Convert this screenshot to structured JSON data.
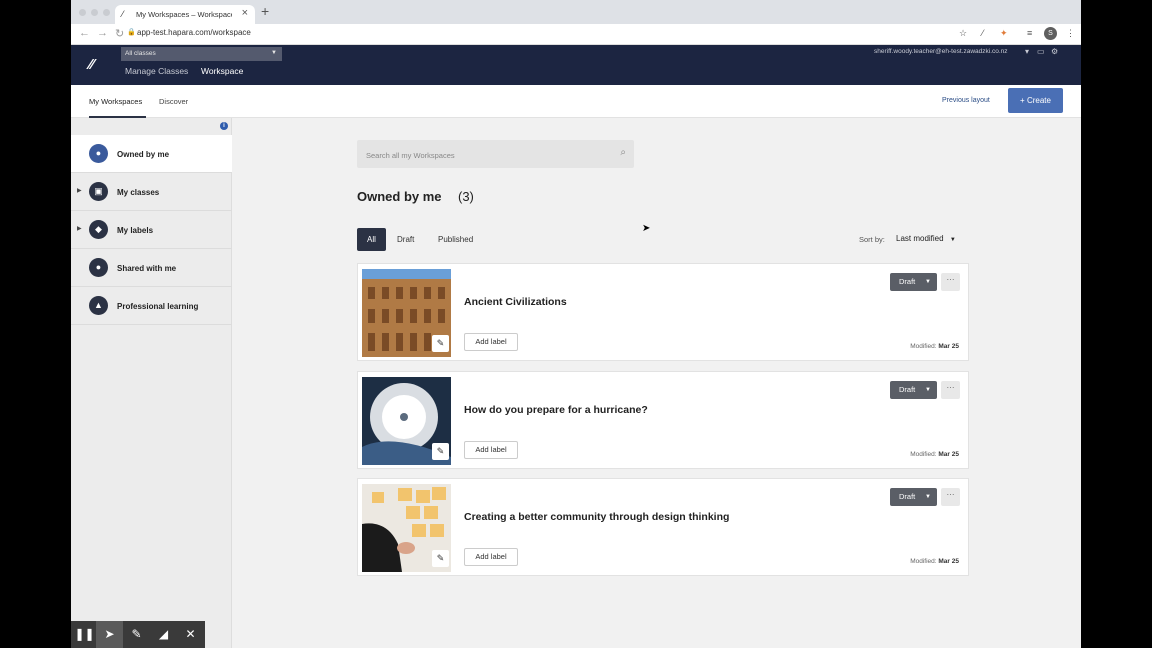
{
  "browser": {
    "tab_title": "My Workspaces – Workspace – H",
    "tab_close": "×",
    "new_tab": "+",
    "url": "app-test.hapara.com/workspace",
    "profile_initial": "S"
  },
  "appbar": {
    "class_select": "All classes",
    "nav": [
      "Manage Classes",
      "Workspace"
    ],
    "user_email": "sheriff.woody.teacher@eh-test.zawadzki.co.nz"
  },
  "subnav": {
    "tabs": [
      "My Workspaces",
      "Discover"
    ],
    "previous_layout": "Previous layout",
    "create": "Create"
  },
  "sidebar": {
    "items": [
      {
        "label": "Owned by me",
        "icon": "person-icon"
      },
      {
        "label": "My classes",
        "icon": "classroom-icon"
      },
      {
        "label": "My labels",
        "icon": "label-icon"
      },
      {
        "label": "Shared with me",
        "icon": "people-icon"
      },
      {
        "label": "Professional learning",
        "icon": "graduation-cap-icon"
      }
    ]
  },
  "main": {
    "search_placeholder": "Search all my Workspaces",
    "section_title": "Owned by me",
    "section_count": "(3)",
    "filters": [
      "All",
      "Draft",
      "Published"
    ],
    "sort_label": "Sort by:",
    "sort_value": "Last modified",
    "cards": [
      {
        "title": "Ancient Civilizations",
        "status": "Draft",
        "label_btn": "Add label",
        "modified_label": "Modified:",
        "modified_date": "Mar 25",
        "more": "···"
      },
      {
        "title": "How do you prepare for a hurricane?",
        "status": "Draft",
        "label_btn": "Add label",
        "modified_label": "Modified:",
        "modified_date": "Mar 25",
        "more": "···"
      },
      {
        "title": "Creating a better community through design thinking",
        "status": "Draft",
        "label_btn": "Add label",
        "modified_label": "Modified:",
        "modified_date": "Mar 25",
        "more": "···"
      }
    ]
  },
  "colors": {
    "appbar": "#1c2541",
    "create_button": "#4a6fb5",
    "status_button": "#5a5e66"
  }
}
